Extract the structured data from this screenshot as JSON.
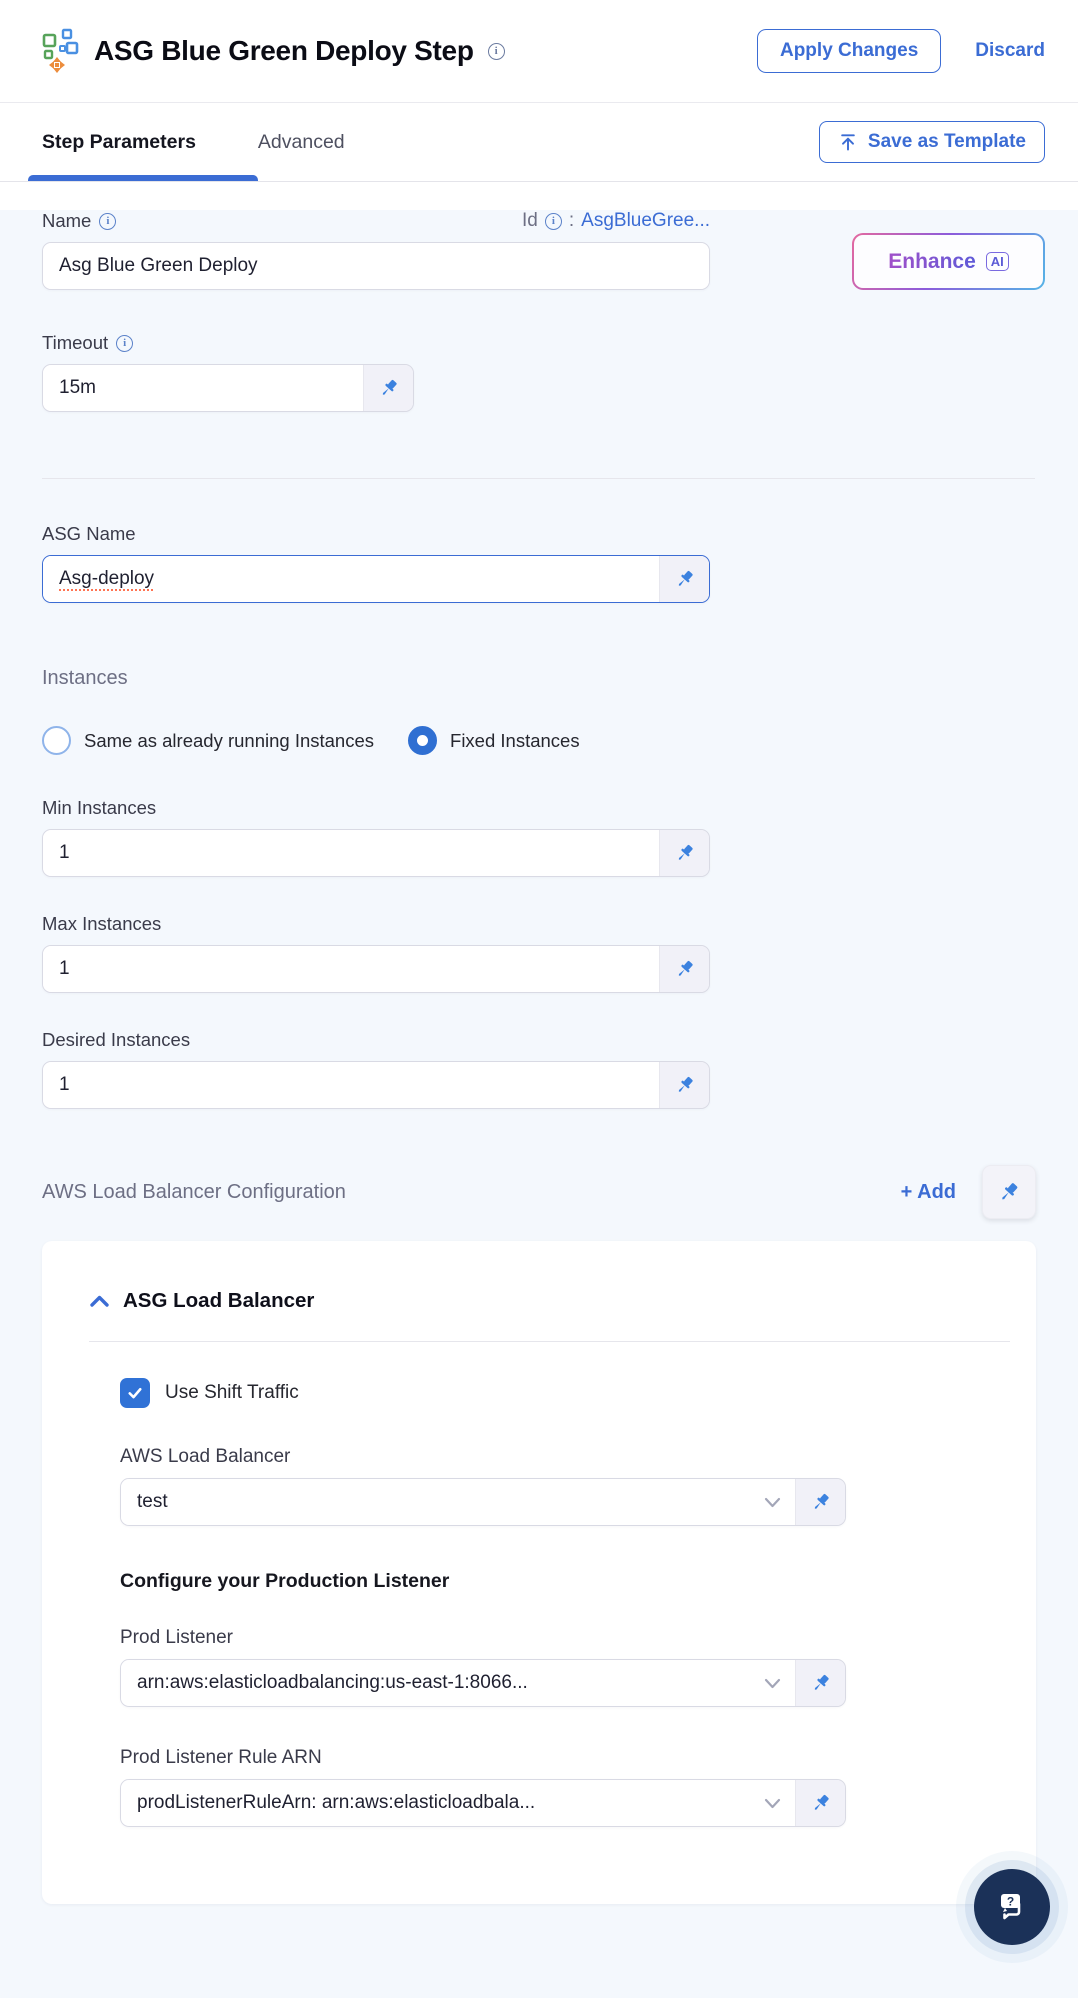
{
  "header": {
    "title": "ASG Blue Green Deploy Step",
    "apply_label": "Apply Changes",
    "discard_label": "Discard"
  },
  "tabs": {
    "step_parameters": "Step Parameters",
    "advanced": "Advanced",
    "save_as_template": "Save as Template"
  },
  "form": {
    "name": {
      "label": "Name",
      "value": "Asg Blue Green Deploy"
    },
    "id": {
      "label": "Id",
      "separator": ":",
      "value": "AsgBlueGree..."
    },
    "enhance": {
      "label": "Enhance",
      "badge": "AI"
    },
    "timeout": {
      "label": "Timeout",
      "value": "15m"
    },
    "asg_name": {
      "label": "ASG Name",
      "value": "Asg-deploy"
    },
    "instances": {
      "heading": "Instances",
      "radio_same_label": "Same as already running Instances",
      "radio_fixed_label": "Fixed Instances",
      "selected": "Fixed Instances",
      "min": {
        "label": "Min Instances",
        "value": "1"
      },
      "max": {
        "label": "Max Instances",
        "value": "1"
      },
      "desired": {
        "label": "Desired Instances",
        "value": "1"
      }
    },
    "lb_config": {
      "heading": "AWS Load Balancer Configuration",
      "add_label": "+ Add",
      "card": {
        "title": "ASG Load Balancer",
        "use_shift_traffic_label": "Use Shift Traffic",
        "use_shift_traffic_checked": true,
        "aws_lb": {
          "label": "AWS Load Balancer",
          "value": "test"
        },
        "prod_section_heading": "Configure your Production Listener",
        "prod_listener": {
          "label": "Prod Listener",
          "value": "arn:aws:elasticloadbalancing:us-east-1:8066..."
        },
        "prod_listener_rule": {
          "label": "Prod Listener Rule ARN",
          "value": "prodListenerRuleArn: arn:aws:elasticloadbala..."
        }
      }
    }
  },
  "colors": {
    "primary_blue": "#3b6cd4",
    "pin_blue": "#3c82df",
    "radio_blue": "#2f6fd2",
    "content_bg": "#f4f8fd",
    "fab_navy": "#1b3158",
    "spellcheck_red": "#ff7452",
    "enhance_gradient": [
      "#e4699f",
      "#8c5bdb",
      "#55b4e6"
    ]
  }
}
